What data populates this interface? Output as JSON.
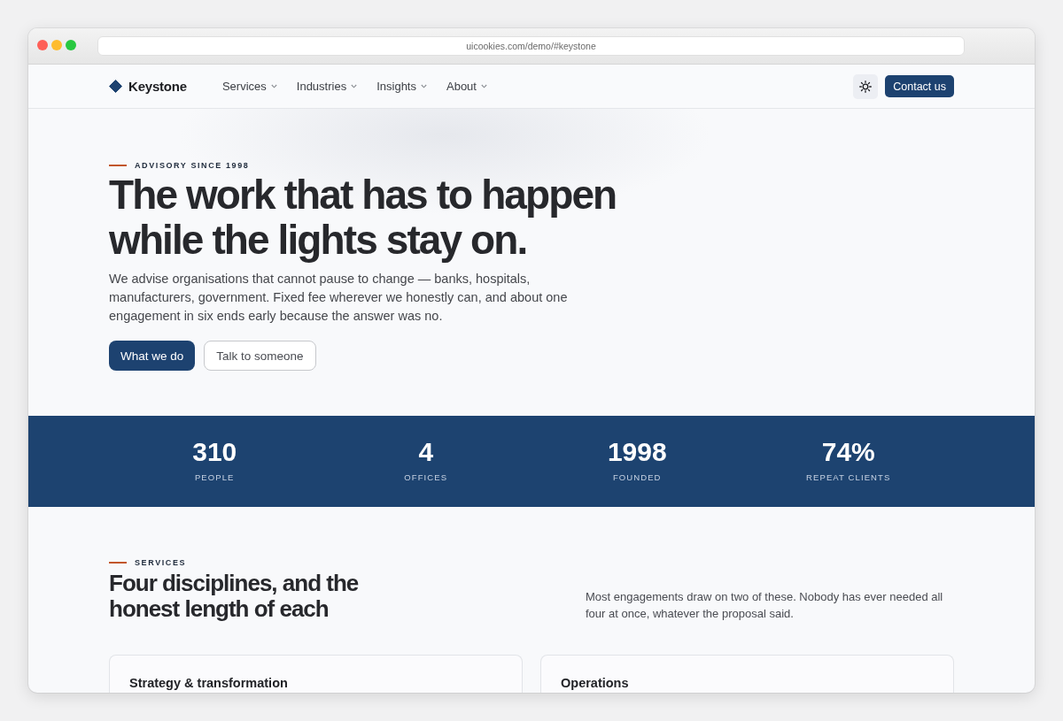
{
  "browser": {
    "url": "uicookies.com/demo/#keystone"
  },
  "nav": {
    "brand": "Keystone",
    "items": [
      {
        "label": "Services"
      },
      {
        "label": "Industries"
      },
      {
        "label": "Insights"
      },
      {
        "label": "About"
      }
    ],
    "cta": "Contact us"
  },
  "hero": {
    "eyebrow": "ADVISORY SINCE 1998",
    "title_lines": [
      "The work that has to happen",
      "while the lights stay on."
    ],
    "body": "We advise organisations that cannot pause to change — banks, hospitals, manufacturers, government. Fixed fee wherever we honestly can, and about one engagement in six ends early because the answer was no.",
    "buttons": [
      {
        "label": "What we do",
        "kind": "primary"
      },
      {
        "label": "Talk to someone",
        "kind": "secondary"
      }
    ]
  },
  "stats": [
    {
      "value": "310",
      "label": "PEOPLE"
    },
    {
      "value": "4",
      "label": "OFFICES"
    },
    {
      "value": "1998",
      "label": "FOUNDED"
    },
    {
      "value": "74%",
      "label": "REPEAT CLIENTS"
    }
  ],
  "services": {
    "eyebrow": "SERVICES",
    "title_lines": [
      "Four disciplines, and the",
      "honest length of each"
    ],
    "intro": "Most engagements draw on two of these. Nobody has ever needed all four at once, whatever the proposal said.",
    "cards": [
      {
        "title": "Strategy & transformation"
      },
      {
        "title": "Operations"
      }
    ]
  }
}
